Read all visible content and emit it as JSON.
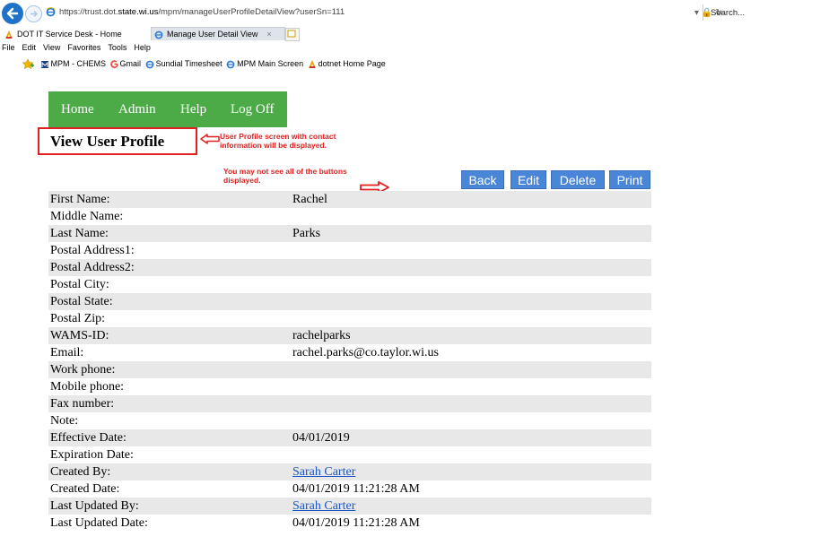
{
  "browser": {
    "url_prefix": "https://trust.dot.",
    "url_domain": "state.wi.us",
    "url_path": "/mpm/manageUserProfileDetailView?userSn=111",
    "address_tools": "▾ 🔒 ↻",
    "search_placeholder": "Search...",
    "tabs": [
      {
        "label": "DOT IT Service Desk - Home",
        "icon": "acrobat-icon"
      },
      {
        "label": "Manage User Detail View",
        "icon": "ie-icon",
        "close": "×"
      }
    ],
    "menu": [
      "File",
      "Edit",
      "View",
      "Favorites",
      "Tools",
      "Help"
    ],
    "favorites": [
      {
        "label": "MPM - CHEMS",
        "icon": "mpm-icon"
      },
      {
        "label": "Gmail",
        "icon": "google-icon"
      },
      {
        "label": "Sundial Timesheet",
        "icon": "ie-icon"
      },
      {
        "label": "MPM Main Screen",
        "icon": "ie-icon"
      },
      {
        "label": "dotnet Home Page",
        "icon": "acrobat-icon"
      }
    ]
  },
  "nav": {
    "items": [
      "Home",
      "Admin",
      "Help",
      "Log Off"
    ],
    "color": "#4caa47"
  },
  "page": {
    "title": "View User Profile",
    "annotation_1": "User Profile screen with contact information will be displayed.",
    "annotation_2": "You may not see all of the buttons displayed.",
    "annotation_color": "#e02020"
  },
  "actions": {
    "back": "Back",
    "edit": "Edit",
    "delete": "Delete",
    "print": "Print",
    "color": "#4a86d8"
  },
  "profile": {
    "rows": [
      {
        "label": "First Name:",
        "value": "Rachel"
      },
      {
        "label": "Middle Name:",
        "value": ""
      },
      {
        "label": "Last Name:",
        "value": "Parks"
      },
      {
        "label": "Postal Address1:",
        "value": ""
      },
      {
        "label": "Postal Address2:",
        "value": ""
      },
      {
        "label": "Postal City:",
        "value": ""
      },
      {
        "label": "Postal State:",
        "value": ""
      },
      {
        "label": "Postal Zip:",
        "value": ""
      },
      {
        "label": "WAMS-ID:",
        "value": "rachelparks"
      },
      {
        "label": "Email:",
        "value": "rachel.parks@co.taylor.wi.us"
      },
      {
        "label": "Work phone:",
        "value": ""
      },
      {
        "label": "Mobile phone:",
        "value": ""
      },
      {
        "label": "Fax number:",
        "value": ""
      },
      {
        "label": "Note:",
        "value": ""
      },
      {
        "label": "Effective Date:",
        "value": "04/01/2019"
      },
      {
        "label": "Expiration Date:",
        "value": ""
      },
      {
        "label": "Created By:",
        "value": "Sarah Carter",
        "link": true
      },
      {
        "label": "Created Date:",
        "value": "04/01/2019 11:21:28 AM"
      },
      {
        "label": "Last Updated By:",
        "value": "Sarah Carter",
        "link": true
      },
      {
        "label": "Last Updated Date:",
        "value": "04/01/2019 11:21:28 AM"
      }
    ]
  }
}
